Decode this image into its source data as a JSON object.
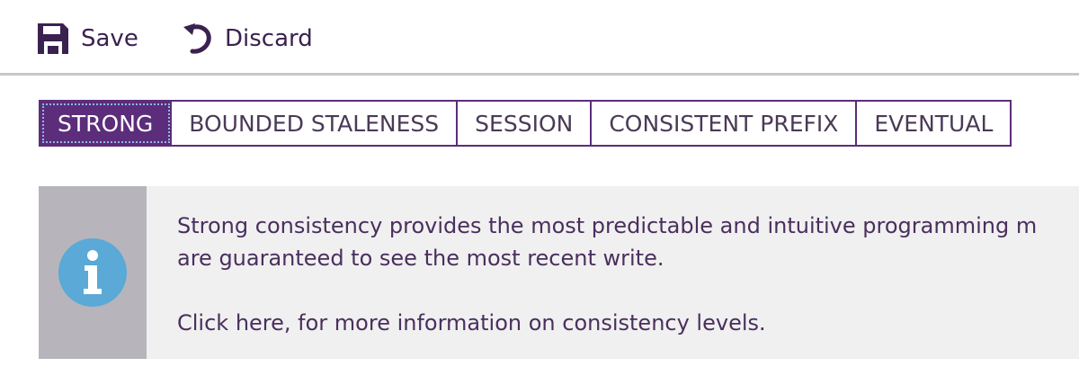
{
  "toolbar": {
    "save_label": "Save",
    "discard_label": "Discard",
    "save_icon": "save-icon",
    "discard_icon": "undo-icon"
  },
  "tabs": [
    {
      "label": "STRONG",
      "active": true
    },
    {
      "label": "BOUNDED STALENESS",
      "active": false
    },
    {
      "label": "SESSION",
      "active": false
    },
    {
      "label": "CONSISTENT PREFIX",
      "active": false
    },
    {
      "label": "EVENTUAL",
      "active": false
    }
  ],
  "info": {
    "icon": "info-icon",
    "line1": "Strong consistency provides the most predictable and intuitive programming m",
    "line2": "are guaranteed to see the most recent write.",
    "link_text": "Click here, for more information on consistency levels."
  },
  "colors": {
    "accent": "#5c2d7a",
    "text": "#4a2f5e",
    "info_icon": "#5aa9d6",
    "panel_bg": "#f0f0f0",
    "panel_side": "#b7b5bb"
  }
}
